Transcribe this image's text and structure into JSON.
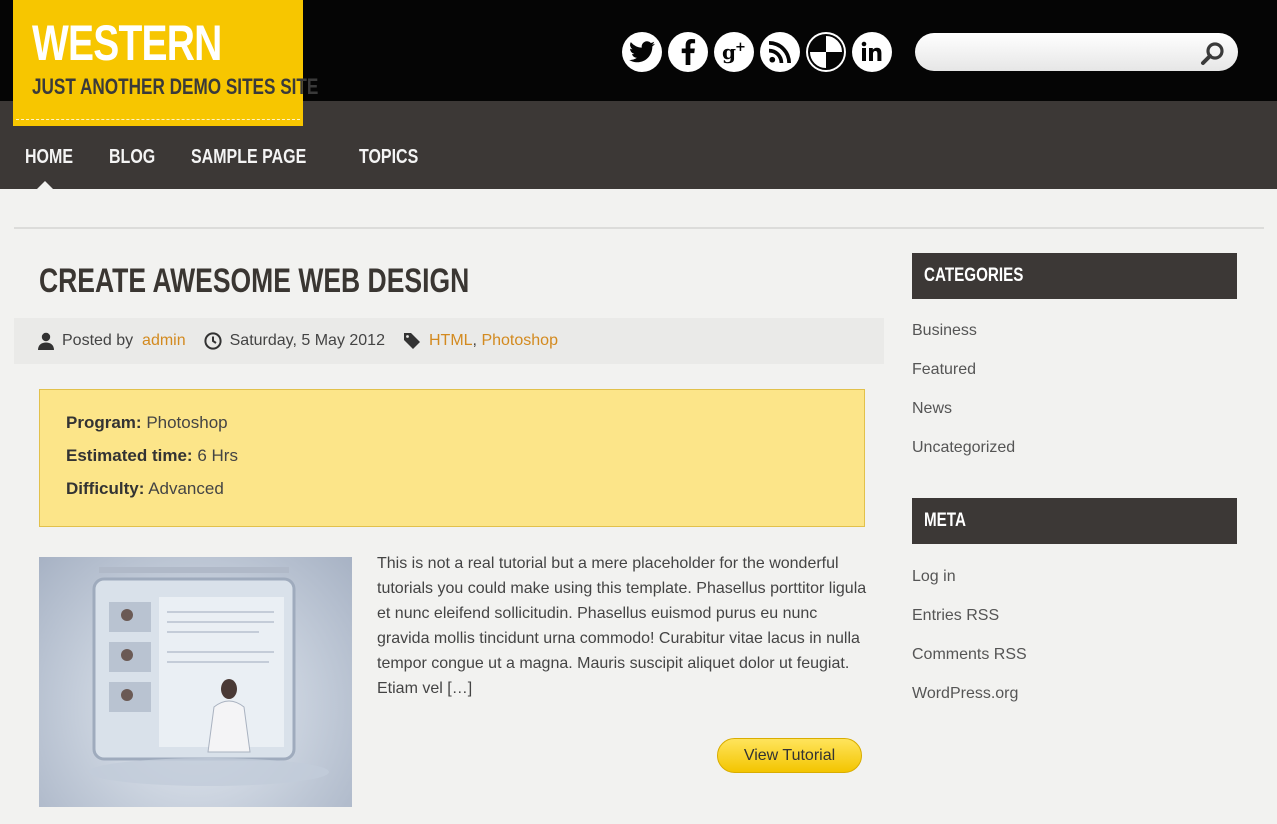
{
  "header": {
    "site_title": "WESTERN",
    "tagline": "JUST ANOTHER DEMO SITES SITE",
    "social": [
      "twitter-icon",
      "facebook-icon",
      "google-plus-icon",
      "rss-icon",
      "delicious-icon",
      "linkedin-icon"
    ],
    "search": {
      "value": "",
      "placeholder": ""
    }
  },
  "nav": {
    "items": [
      "HOME",
      "BLOG",
      "SAMPLE PAGE",
      "TOPICS"
    ],
    "active": "HOME"
  },
  "post": {
    "title": "CREATE AWESOME WEB DESIGN",
    "meta": {
      "posted_by_label": "Posted by",
      "author": "admin",
      "date": "Saturday, 5 May 2012",
      "tags": [
        "HTML",
        "Photoshop"
      ],
      "tag_separator": ","
    },
    "info": {
      "program_label": "Program:",
      "program_value": "Photoshop",
      "time_label": "Estimated time:",
      "time_value": "6 Hrs",
      "difficulty_label": "Difficulty:",
      "difficulty_value": "Advanced"
    },
    "excerpt": "This is not a real tutorial but a mere placeholder for the wonderful tutorials you could make using this template. Phasellus porttitor ligula et nunc eleifend sollicitudin. Phasellus euismod purus eu nunc gravida mollis tincidunt urna commodo! Curabitur vitae lacus in nulla tempor congue ut a magna. Mauris suscipit aliquet dolor ut feugiat. Etiam vel […]",
    "button_label": "View Tutorial"
  },
  "sidebar": {
    "categories_title": "CATEGORIES",
    "categories": [
      "Business",
      "Featured",
      "News",
      "Uncategorized"
    ],
    "meta_title": "META",
    "meta_links": [
      "Log in",
      "Entries RSS",
      "Comments RSS",
      "WordPress.org"
    ]
  },
  "colors": {
    "accent": "#f7c600",
    "link": "#d38a1f",
    "header_bg": "#050505",
    "nav_bg": "#3c3836"
  }
}
